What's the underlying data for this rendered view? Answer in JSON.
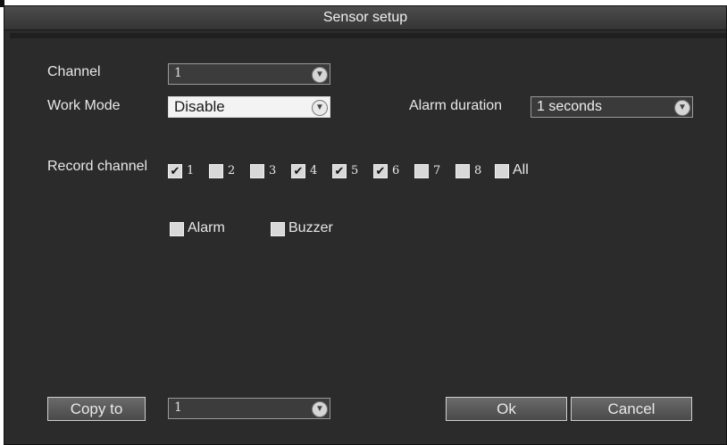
{
  "dialog": {
    "title": "Sensor setup"
  },
  "channel": {
    "label": "Channel",
    "value": "1"
  },
  "work_mode": {
    "label": "Work Mode",
    "value": "Disable"
  },
  "alarm_duration": {
    "label": "Alarm duration",
    "value": "1 seconds"
  },
  "record_channel": {
    "label": "Record channel",
    "items": [
      {
        "label": "1",
        "checked": true
      },
      {
        "label": "2",
        "checked": false
      },
      {
        "label": "3",
        "checked": false
      },
      {
        "label": "4",
        "checked": true
      },
      {
        "label": "5",
        "checked": true
      },
      {
        "label": "6",
        "checked": true
      },
      {
        "label": "7",
        "checked": false
      },
      {
        "label": "8",
        "checked": false
      }
    ],
    "all_label": "All",
    "all_checked": false
  },
  "outputs": {
    "alarm": {
      "label": "Alarm",
      "checked": false
    },
    "buzzer": {
      "label": "Buzzer",
      "checked": false
    }
  },
  "footer": {
    "copy_to_label": "Copy to",
    "copy_to_value": "1",
    "ok_label": "Ok",
    "cancel_label": "Cancel"
  },
  "icons": {
    "dropdown": "chevron-down-icon",
    "check": "checkmark-icon"
  }
}
